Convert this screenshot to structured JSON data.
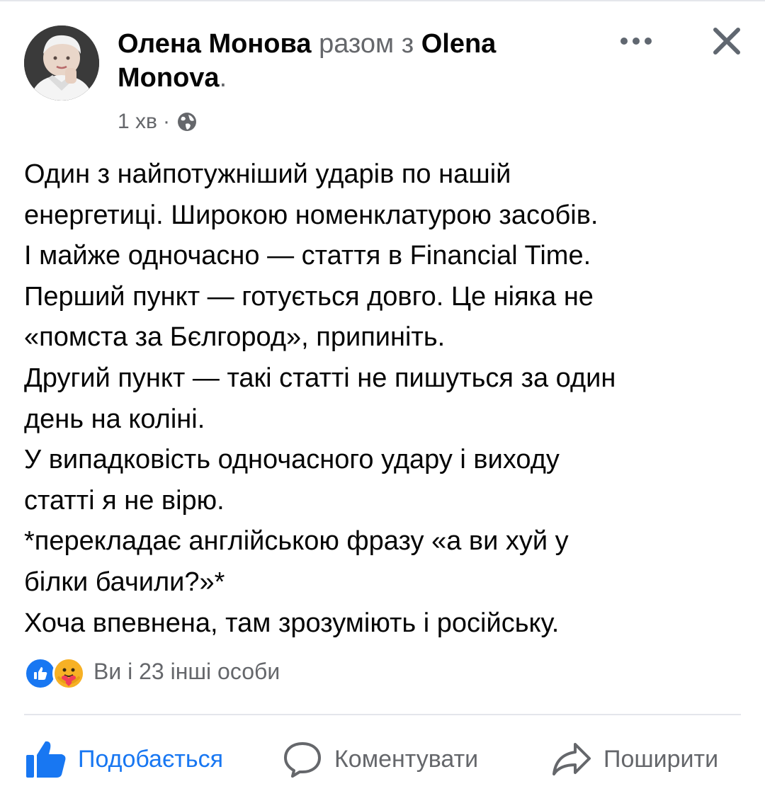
{
  "post": {
    "author": "Олена Монова",
    "joiner": "разом з",
    "co_author": "Olena Monova",
    "period": ".",
    "time": "1 хв",
    "meta_sep": "·",
    "lines": [
      "Один з найпотужніший ударів по нашій",
      "енергетиці. Широкою номенклатурою засобів.",
      "І майже одночасно — стаття в Financial Time.",
      "Перший пункт — готується довго. Це ніяка не",
      "«помста за Бєлгород», припиніть.",
      "Другий пункт — такі статті не пишуться за один",
      "день на коліні.",
      "У випадковість одночасного удару і виходу",
      "статті я не вірю.",
      "*перекладає англійською фразу «а ви хуй у",
      "білки бачили?»*",
      "Хоча впевнена, там зрозуміють і російську."
    ]
  },
  "reactions": {
    "summary": "Ви і 23 інші особи",
    "types": [
      "like-icon",
      "care-icon"
    ]
  },
  "actions": {
    "like_label": "Подобається",
    "comment_label": "Коментувати",
    "share_label": "Поширити"
  },
  "icons": {
    "more": "more-dots-icon",
    "close": "close-icon",
    "privacy": "globe-icon"
  },
  "colors": {
    "primary_text": "#050505",
    "secondary_text": "#65676b",
    "accent": "#1877f2",
    "divider": "#e4e6eb",
    "care_reaction": "#f7b125"
  }
}
